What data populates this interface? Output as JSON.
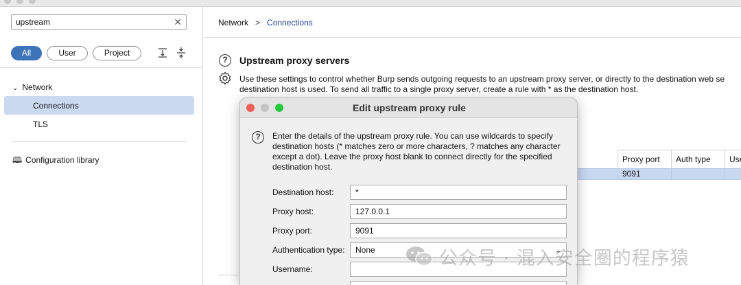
{
  "search": {
    "value": "upstream"
  },
  "filters": {
    "all": "All",
    "user": "User",
    "project": "Project"
  },
  "tree": {
    "network": "Network",
    "connections": "Connections",
    "tls": "TLS",
    "config_library": "Configuration library"
  },
  "breadcrumb": {
    "root": "Network",
    "separator": ">",
    "current": "Connections"
  },
  "section": {
    "title": "Upstream proxy servers",
    "line1": "Use these settings to control whether Burp sends outgoing requests to an upstream proxy server, or directly to the destination web se",
    "line2": "destination host is used. To send all traffic to a single proxy server, create a rule with * as the destination host."
  },
  "table": {
    "headers": [
      "Proxy port",
      "Auth type",
      "Use"
    ],
    "rows": [
      {
        "proxy_port": "9091"
      }
    ]
  },
  "dialog": {
    "title": "Edit upstream proxy rule",
    "instructions": "Enter the details of the upstream proxy rule. You can use wildcards to specify destination hosts (* matches zero or more characters, ? matches any character except a dot). Leave the proxy host blank to connect directly for the specified destination host.",
    "fields": {
      "destination_host_label": "Destination host:",
      "destination_host_value": "*",
      "proxy_host_label": "Proxy host:",
      "proxy_host_value": "127.0.0.1",
      "proxy_port_label": "Proxy port:",
      "proxy_port_value": "9091",
      "auth_type_label": "Authentication type:",
      "auth_type_value": "None",
      "username_label": "Username:",
      "username_value": ""
    }
  },
  "watermark": {
    "text": "公众号 · 混入安全圈的程序猿"
  },
  "colors": {
    "accent": "#3d73b9",
    "selection": "#cbd9ef",
    "link": "#23408f"
  }
}
